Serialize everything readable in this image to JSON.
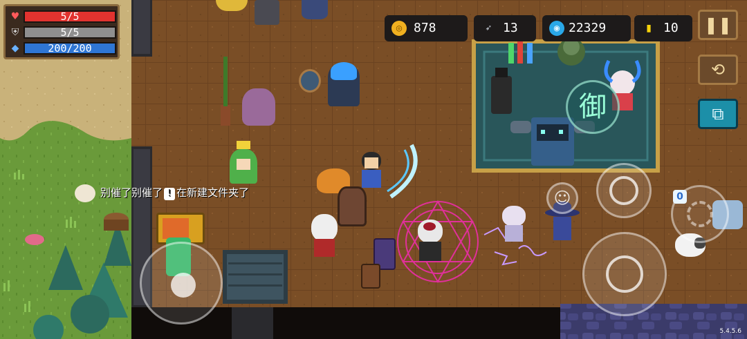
{
  "hud": {
    "health": "5/5",
    "armor": "5/5",
    "energy": "200/200",
    "health_fraction": 1.0,
    "armor_fraction": 1.0,
    "energy_fraction": 1.0
  },
  "resources": {
    "coins": "878",
    "fish": "13",
    "gems": "22329",
    "gold": "10"
  },
  "chat": {
    "message_before": "别催了别催了",
    "message_after": "在新建文件夹了"
  },
  "shop_sign": "御",
  "skill_badge": "0",
  "version": "5.4.5.6",
  "colors": {
    "health": "#e2332f",
    "armor": "#8f8f8f",
    "energy": "#2f76d4",
    "floor": "#7a4e26",
    "sand": "#c9b27a",
    "grass": "#6a9a3a",
    "shop_carpet": "#29565a",
    "magic_circle": "#e0309a"
  },
  "icons": {
    "health": "heart-icon",
    "armor": "shield-icon",
    "energy": "diamond-icon",
    "coin": "coin-icon",
    "fish": "fish-icon",
    "gem": "gem-icon",
    "gold": "gold-icon",
    "pause": "pause-icon",
    "swap": "swap-weapon-icon",
    "map": "minimap-icon",
    "emote": "emote-icon",
    "aim": "aim-icon",
    "attack": "crosshair-icon",
    "skill": "skill-icon"
  }
}
